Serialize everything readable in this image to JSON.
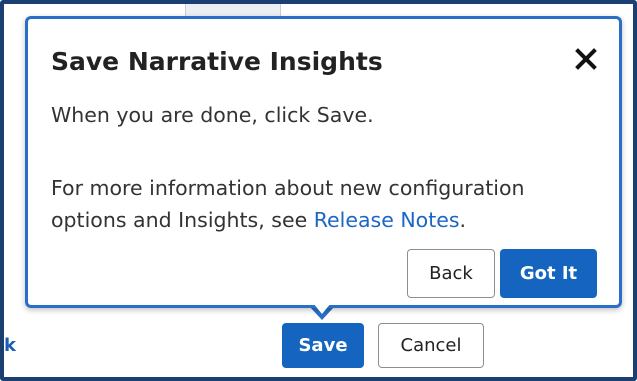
{
  "background": {
    "partial_link_text": "k",
    "save_label": "Save",
    "cancel_label": "Cancel"
  },
  "dialog": {
    "title": "Save Narrative Insights",
    "close_icon": "close-icon",
    "line1": "When you are done, click Save.",
    "line2_part1": "For more information about new configuration",
    "line2_part2": "options and Insights, see ",
    "release_notes_link": "Release Notes",
    "line2_end": ".",
    "back_label": "Back",
    "got_it_label": "Got It"
  },
  "colors": {
    "primary": "#1565c0",
    "dialog_border": "#2a6fc7",
    "link": "#1a66c5",
    "frame": "#1c3f73"
  }
}
